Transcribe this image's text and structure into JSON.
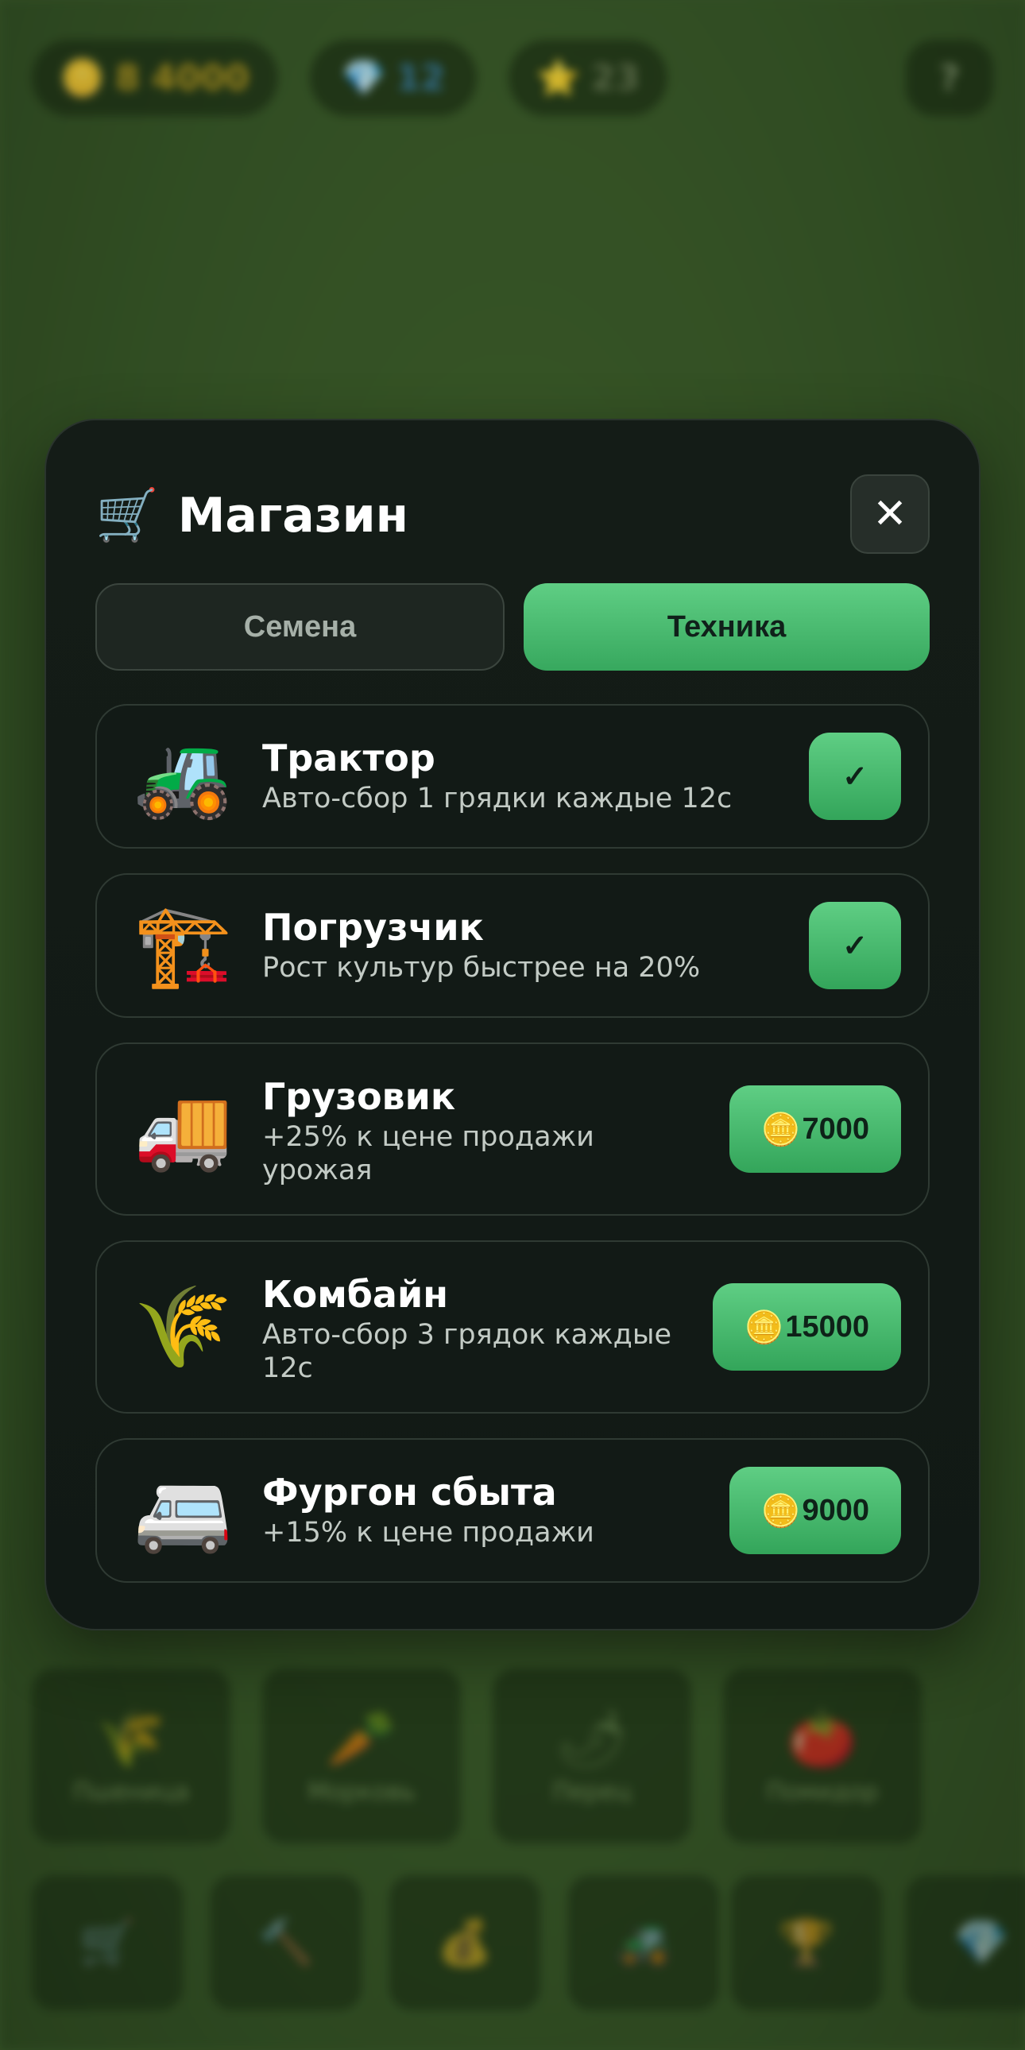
{
  "background": {
    "top_pills": [
      {
        "icon": "🪙",
        "value": "8 4000"
      },
      {
        "icon": "💎",
        "value": "12"
      },
      {
        "icon": "⭐",
        "value": "23"
      }
    ],
    "crop_cards": [
      {
        "icon": "🌾",
        "label": "Пшеница"
      },
      {
        "icon": "🥕",
        "label": "Морковь"
      },
      {
        "icon": "🌶",
        "label": "Перец"
      },
      {
        "icon": "🍅",
        "label": "Помидор"
      }
    ],
    "nav_items": [
      {
        "icon": "🛒"
      },
      {
        "icon": "🔨"
      },
      {
        "icon": "💰"
      },
      {
        "icon": "🚜"
      },
      {
        "icon": "🏆"
      },
      {
        "icon": "💎"
      }
    ]
  },
  "shop": {
    "icon": "🛒",
    "title": "Магазин",
    "close_label": "✕",
    "tabs": [
      {
        "label": "Семена",
        "active": false
      },
      {
        "label": "Техника",
        "active": true
      }
    ],
    "items": [
      {
        "icon": "🚜",
        "name": "Трактор",
        "desc": "Авто-сбор 1 грядки каждые 12с",
        "owned": true,
        "owned_label": "✓"
      },
      {
        "icon": "🏗️",
        "name": "Погрузчик",
        "desc": "Рост культур быстрее на 20%",
        "owned": true,
        "owned_label": "✓"
      },
      {
        "icon": "🚚",
        "name": "Грузовик",
        "desc": "+25% к цене продажи урожая",
        "owned": false,
        "coin": "🪙",
        "price": "7000"
      },
      {
        "icon": "🌾",
        "name": "Комбайн",
        "desc": "Авто-сбор 3 грядок каждые 12с",
        "owned": false,
        "coin": "🪙",
        "price": "15000"
      },
      {
        "icon": "🚐",
        "name": "Фургон сбыта",
        "desc": "+15% к цене продажи",
        "owned": false,
        "coin": "🪙",
        "price": "9000"
      }
    ]
  },
  "colors": {
    "accent_green": "#4cc072",
    "modal_bg": "#131b17",
    "background_green": "#3b5a2c"
  }
}
